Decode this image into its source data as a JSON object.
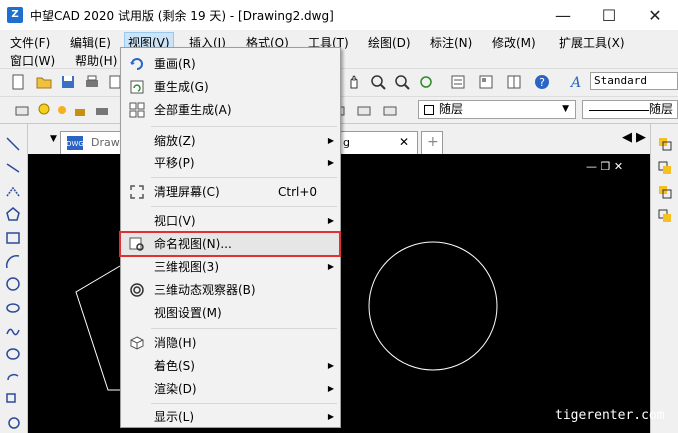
{
  "window": {
    "title": "中望CAD 2020 试用版 (剩余 19 天) - [Drawing2.dwg]",
    "minimize": "—",
    "maximize": "☐",
    "close": "✕"
  },
  "menubar": {
    "row1": [
      "文件(F)",
      "编辑(E)",
      "视图(V)",
      "插入(I)",
      "格式(O)",
      "工具(T)",
      "绘图(D)",
      "标注(N)",
      "修改(M)",
      "扩展工具(X)"
    ],
    "row2": [
      "窗口(W)",
      "帮助(H)"
    ]
  },
  "toolbar": {
    "text_style": "Standard",
    "layer": "随层",
    "linetype": "随层"
  },
  "tabs": {
    "doc_tab1": "Drawin",
    "doc_tab2": "g",
    "doc_tab2_close": "✕",
    "add_tab": "+"
  },
  "canvas": {
    "background": "#000000",
    "watermark": "tigerenter.com",
    "ctrls": "— ❐ ✕"
  },
  "view_menu": {
    "items": [
      {
        "label": "重画(R)",
        "icon": "redraw-icon"
      },
      {
        "label": "重生成(G)",
        "icon": "regen-icon"
      },
      {
        "label": "全部重生成(A)",
        "icon": "regen-all-icon"
      },
      {
        "label": "缩放(Z)",
        "submenu": "▶"
      },
      {
        "label": "平移(P)",
        "submenu": "▶"
      },
      {
        "label": "清理屏幕(C)",
        "shortcut": "Ctrl+0",
        "icon": "clean-screen-icon"
      },
      {
        "label": "视口(V)",
        "submenu": "▶"
      },
      {
        "label": "命名视图(N)...",
        "icon": "named-view-icon"
      },
      {
        "label": "三维视图(3)",
        "submenu": "▶"
      },
      {
        "label": "三维动态观察器(B)",
        "icon": "orbit-icon"
      },
      {
        "label": "视图设置(M)"
      },
      {
        "label": "消隐(H)",
        "icon": "hide-icon"
      },
      {
        "label": "着色(S)",
        "submenu": "▶"
      },
      {
        "label": "渲染(D)",
        "submenu": "▶"
      },
      {
        "label": "显示(L)",
        "submenu": "▶"
      }
    ]
  },
  "colors": {
    "highlight_border": "#e03030",
    "menu_active_bg": "#cce4f7"
  }
}
